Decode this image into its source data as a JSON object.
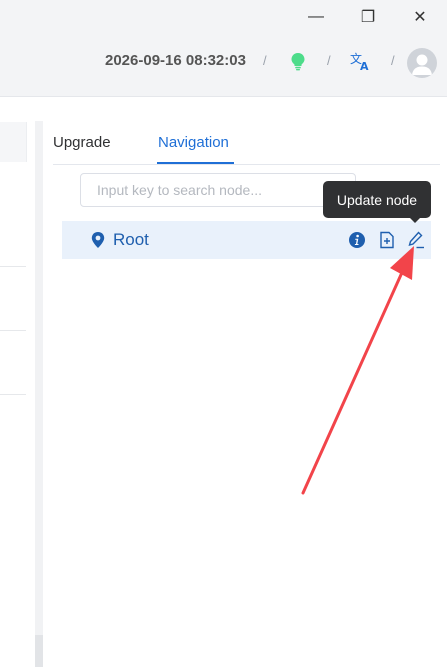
{
  "window": {
    "minimize_label": "—",
    "maximize_label": "❐",
    "close_label": "✕"
  },
  "header": {
    "datetime": "2026-09-16 08:32:03",
    "separator": "/",
    "status_icon": "lightbulb-icon",
    "status_color": "#4ddc8a",
    "language_icon": "translate-icon",
    "avatar_icon": "user-avatar-icon"
  },
  "tabs": [
    {
      "label": "Upgrade",
      "active": false
    },
    {
      "label": "Navigation",
      "active": true
    }
  ],
  "search": {
    "placeholder": "Input key to search node...",
    "value": ""
  },
  "tree": {
    "nodes": [
      {
        "label": "Root",
        "icon": "location-pin-icon",
        "actions": [
          "info-icon",
          "add-file-icon",
          "edit-icon"
        ]
      }
    ]
  },
  "tooltip": {
    "text": "Update node"
  },
  "colors": {
    "accent": "#1f6fd6",
    "selected_row_bg": "#e9f1fb",
    "annotation_arrow": "#f2444a"
  }
}
